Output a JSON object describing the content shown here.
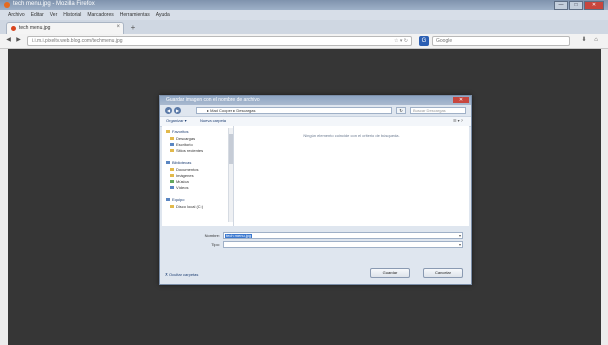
{
  "window": {
    "title": "tech menu.jpg - Mozilla Firefox",
    "buttons": {
      "minimize": "—",
      "maximize": "□",
      "close": "✕"
    }
  },
  "menu": [
    "Archivo",
    "Editar",
    "Ver",
    "Historial",
    "Marcadores",
    "Herramientas",
    "Ayuda"
  ],
  "tab": {
    "label": "tech menu.jpg",
    "close": "×",
    "new": "+"
  },
  "nav": {
    "back": "◀",
    "forward": "▶",
    "url": "i.i.m.i.pixeltv.web.blog.com/techmenu.jpg",
    "url_icons": "☆ ▾ ↻",
    "search_engine": "G",
    "search_placeholder": "Google",
    "home_icon": "⌂",
    "download_icon": "⬇"
  },
  "dialog": {
    "title": "Guardar imagen con el nombre de archivo",
    "close": "✕",
    "breadcrumb": "▸ Mad Cooper ▸ Descargas",
    "refresh": "↻",
    "search_placeholder": "Buscar Descargas",
    "toolbar": {
      "organize": "Organizar ▾",
      "new_folder": "Nueva carpeta",
      "view": "☰ ▾  ?"
    },
    "nav_items": [
      {
        "label": "Favoritos",
        "icon": "star",
        "group": true
      },
      {
        "label": "Descargas",
        "icon": "folder",
        "group": false
      },
      {
        "label": "Escritorio",
        "icon": "folder-blue",
        "group": false
      },
      {
        "label": "Sitios recientes",
        "icon": "folder",
        "group": false
      },
      {
        "label": "Bibliotecas",
        "icon": "library",
        "group": true
      },
      {
        "label": "Documentos",
        "icon": "folder",
        "group": false
      },
      {
        "label": "Imágenes",
        "icon": "folder",
        "group": false
      },
      {
        "label": "Música",
        "icon": "folder-green",
        "group": false
      },
      {
        "label": "Vídeos",
        "icon": "folder-blue",
        "group": false
      },
      {
        "label": "Equipo",
        "icon": "computer",
        "group": true
      },
      {
        "label": "Disco local (C:)",
        "icon": "drive",
        "group": false
      }
    ],
    "empty_message": "Ningún elemento coincide con el criterio de búsqueda.",
    "filename_label": "Nombre:",
    "filename_value": "tech menu.jpg",
    "type_label": "Tipo:",
    "type_value": "",
    "hide_folders": "⊼ Ocultar carpetas",
    "save": "Guardar",
    "cancel": "Cancelar"
  }
}
